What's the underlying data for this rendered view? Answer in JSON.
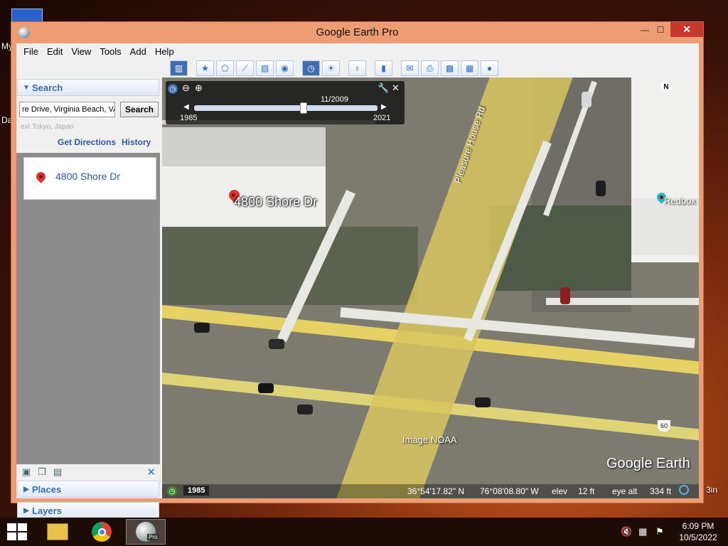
{
  "desktop": {
    "left_labels": [
      "My",
      "Da"
    ],
    "right_label": "3in"
  },
  "window": {
    "title": "Google Earth Pro",
    "controls": {
      "minimize": "—",
      "maximize": "☐",
      "close": "✕"
    }
  },
  "menu": [
    "File",
    "Edit",
    "View",
    "Tools",
    "Add",
    "Help"
  ],
  "search_panel": {
    "header": "Search",
    "input_value": "re Drive, Virginia Beach, VA",
    "search_button": "Search",
    "hint": "ext Tokyo, Japan",
    "get_directions": "Get Directions",
    "history": "History",
    "results": [
      {
        "label": "4800 Shore Dr"
      }
    ]
  },
  "places": {
    "header": "Places"
  },
  "layers": {
    "header": "Layers"
  },
  "toolbar_icons": [
    "sidebar-toggle-icon",
    "placemark-icon",
    "polygon-icon",
    "path-icon",
    "image-overlay-icon",
    "record-tour-icon",
    "historical-imagery-icon",
    "sunlight-icon",
    "planets-icon",
    "ruler-icon",
    "email-icon",
    "print-icon",
    "save-image-icon",
    "view-in-maps-icon",
    "earth-gallery-icon"
  ],
  "time_slider": {
    "date": "11/2009",
    "start_year": "1985",
    "end_year": "2021",
    "position": 0.6
  },
  "map": {
    "placemark_label": "4800 Shore Dr",
    "road_label": "Pleasure House Rd",
    "poi_label": "Redbox",
    "image_credit": "Image NOAA",
    "watermark": "Google Earth",
    "route_shield": "60",
    "compass": "N"
  },
  "status": {
    "year": "1985",
    "lat": "36°54'17.82\" N",
    "lon": "76°08'08.80\" W",
    "elev_label": "elev",
    "elev": "12 ft",
    "eye_alt_label": "eye alt",
    "eye_alt": "334 ft"
  },
  "taskbar": {
    "apps": [
      "file-explorer",
      "chrome",
      "google-earth-pro"
    ],
    "pro_badge": "Pro",
    "time": "6:09 PM",
    "date": "10/5/2022"
  },
  "colors": {
    "window_frame": "#ee9c73",
    "close_red": "#c7372c",
    "link_blue": "#2c5aa0",
    "road_yellow": "#e6d264"
  }
}
